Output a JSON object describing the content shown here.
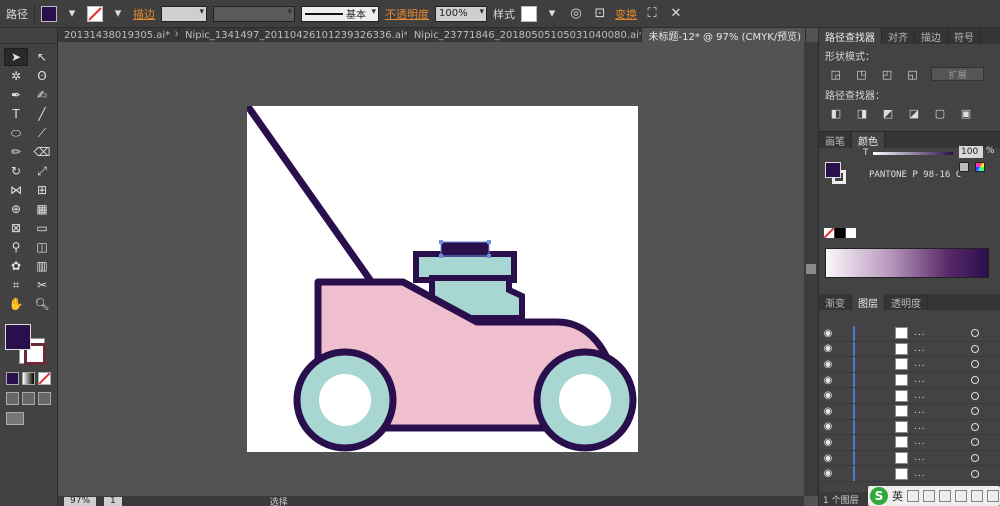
{
  "control_bar": {
    "object_type": "路径",
    "stroke_label": "描边",
    "brush_value": "基本",
    "opacity_label": "不透明度",
    "opacity_value": "100%",
    "style_label": "样式",
    "transform_label": "变换"
  },
  "tabs": [
    {
      "label": "20131438019305.ai*"
    },
    {
      "label": "Nipic_1341497_20110426101239326336.ai*"
    },
    {
      "label": "Nipic_23771846_20180505105031040080.ai*"
    },
    {
      "label": "未标题-12* @ 97% (CMYK/预览)"
    }
  ],
  "status": {
    "zoom": "97%",
    "page": "1",
    "mode": "选择"
  },
  "pathfinder": {
    "tabs": [
      "路径查找器",
      "对齐",
      "描边",
      "符号"
    ],
    "shape_modes_label": "形状模式：",
    "pathfinders_label": "路径查找器：",
    "expand_label": "扩展"
  },
  "color": {
    "tabs": [
      "画笔",
      "颜色"
    ],
    "tint_label": "T",
    "tint_value": "100",
    "percent": "%",
    "swatch_name": "PANTONE P 98-16 C",
    "fill_color": "#2a0f4d"
  },
  "layers": {
    "tabs": [
      "渐变",
      "图层",
      "透明度"
    ],
    "rows": [
      "...",
      "...",
      "...",
      "...",
      "...",
      "...",
      "...",
      "...",
      "...",
      "..."
    ],
    "footer": "1 个图层"
  },
  "ime": {
    "label": "英"
  },
  "artwork": {
    "handle_color": "#2a0f4d",
    "body_color": "#f0bfcd",
    "engine_color": "#a8d6d2",
    "wheel_hub_color": "#ffffff"
  }
}
